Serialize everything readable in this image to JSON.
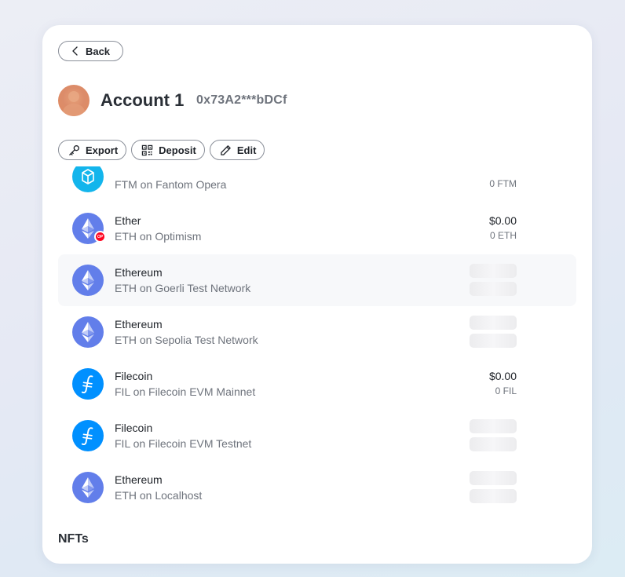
{
  "header": {
    "back_label": "Back",
    "account_name": "Account 1",
    "account_address": "0x73A2***bDCf"
  },
  "actions": [
    {
      "label": "Export",
      "icon": "key-icon"
    },
    {
      "label": "Deposit",
      "icon": "qr-code-icon"
    },
    {
      "label": "Edit",
      "icon": "pencil-icon"
    }
  ],
  "assets": [
    {
      "name": "",
      "network": "FTM on Fantom Opera",
      "fiat": "",
      "balance": "0 FTM",
      "icon": "fantom-icon",
      "loading": false
    },
    {
      "name": "Ether",
      "network": "ETH on Optimism",
      "fiat": "$0.00",
      "balance": "0 ETH",
      "icon": "ethereum-icon",
      "badge": "OP",
      "loading": false
    },
    {
      "name": "Ethereum",
      "network": "ETH on Goerli Test Network",
      "icon": "ethereum-icon",
      "loading": true
    },
    {
      "name": "Ethereum",
      "network": "ETH on Sepolia Test Network",
      "icon": "ethereum-icon",
      "loading": true
    },
    {
      "name": "Filecoin",
      "network": "FIL on Filecoin EVM Mainnet",
      "fiat": "$0.00",
      "balance": "0 FIL",
      "icon": "filecoin-icon",
      "loading": false
    },
    {
      "name": "Filecoin",
      "network": "FIL on Filecoin EVM Testnet",
      "icon": "filecoin-icon",
      "loading": true
    },
    {
      "name": "Ethereum",
      "network": "ETH on Localhost",
      "icon": "ethereum-icon",
      "loading": true
    }
  ],
  "nfts": {
    "title": "NFTs"
  },
  "colors": {
    "ethereum": "#627eea",
    "filecoin": "#0090ff",
    "fantom": "#13b5ec",
    "optimism": "#ff0420"
  }
}
